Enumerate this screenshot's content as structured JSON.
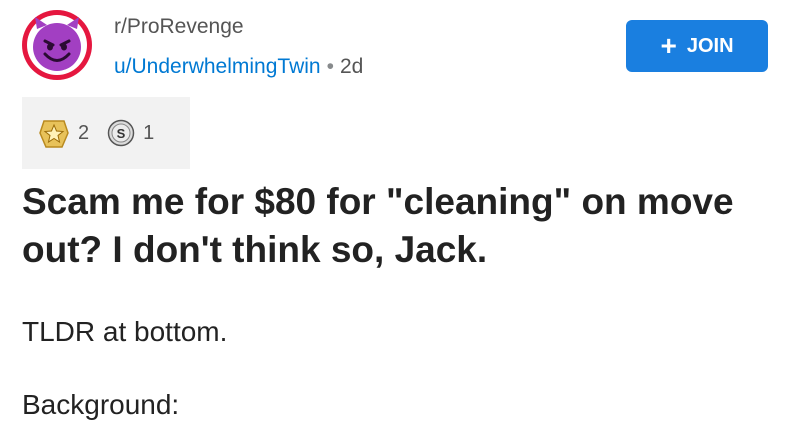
{
  "header": {
    "subreddit": "r/ProRevenge",
    "username": "u/UnderwhelmingTwin",
    "separator": "•",
    "age": "2d",
    "join_label": "JOIN",
    "join_icon": "plus-icon",
    "avatar_icon": "smiling-devil-icon"
  },
  "awards": [
    {
      "icon": "star-award-icon",
      "count": "2"
    },
    {
      "icon": "silver-award-icon",
      "count": "1"
    }
  ],
  "post": {
    "title": "Scam me for $80 for \"cleaning\" on move out? I don't think so, Jack.",
    "paragraphs": [
      "TLDR at bottom.",
      "Background:"
    ]
  },
  "colors": {
    "accent": "#1a7fe0",
    "username": "#0079d3",
    "avatar_ring": "#e5173f",
    "avatar_face": "#a23fc2"
  }
}
